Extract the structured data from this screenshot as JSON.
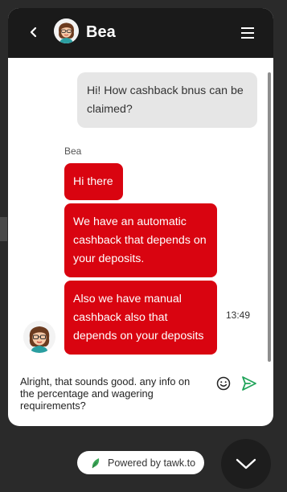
{
  "header": {
    "agent_name": "Bea",
    "back_icon": "chevron-left-icon",
    "menu_icon": "hamburger-menu-icon"
  },
  "messages": {
    "visitor": {
      "text": "Hi! How cashback bnus can be claimed?"
    },
    "agent": {
      "sender": "Bea",
      "bubbles": [
        "Hi there",
        "We have an automatic cashback that depends on your deposits.",
        "Also we have manual cashback also that depends on your deposits"
      ],
      "time": "13:49"
    }
  },
  "composer": {
    "value": "Alright, that sounds good. any info on the percentage and wagering requirements?",
    "emoji_icon": "smiley-icon",
    "send_icon": "send-icon"
  },
  "footer": {
    "powered_by": "Powered by tawk.to",
    "minimize_icon": "chevron-down-icon"
  },
  "colors": {
    "header_bg": "#1a1a1a",
    "agent_bubble": "#d90410",
    "visitor_bubble": "#e6e6e6",
    "send_icon": "#21a45a",
    "page_bg": "#2a2a2a"
  }
}
